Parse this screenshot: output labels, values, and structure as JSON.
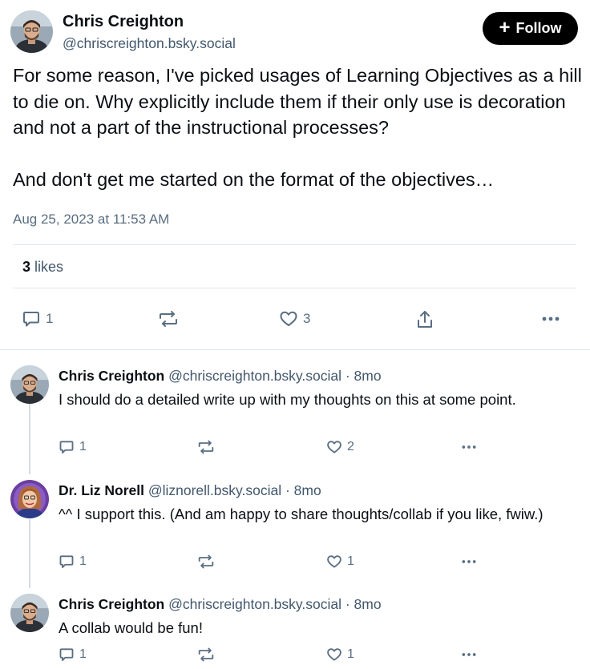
{
  "post": {
    "author_name": "Chris Creighton",
    "author_handle": "@chriscreighton.bsky.social",
    "follow_label": "Follow",
    "text": "For some reason, I've picked usages of Learning Objectives as a hill to die on. Why explicitly include them if their only use is decoration and not a part of the instructional processes?\n\nAnd don't get me started on the format of the objectives…",
    "timestamp": "Aug 25, 2023 at 11:53 AM",
    "likes_count": "3",
    "likes_label": "likes",
    "actions": {
      "reply_count": "1",
      "repost_count": "",
      "like_count": "3"
    }
  },
  "replies": [
    {
      "name": "Chris Creighton",
      "handle": "@chriscreighton.bsky.social",
      "time": "8mo",
      "text": "I should do a detailed write up with my thoughts on this at some point.",
      "reply_count": "1",
      "repost_count": "",
      "like_count": "2"
    },
    {
      "name": "Dr. Liz Norell",
      "handle": "@liznorell.bsky.social",
      "time": "8mo",
      "text": "^^ I support this. (And am happy to share thoughts/collab if you like, fwiw.)",
      "reply_count": "1",
      "repost_count": "",
      "like_count": "1"
    },
    {
      "name": "Chris Creighton",
      "handle": "@chriscreighton.bsky.social",
      "time": "8mo",
      "text": "A collab would be fun!",
      "reply_count": "1",
      "repost_count": "",
      "like_count": "1"
    }
  ],
  "separator": "·",
  "colors": {
    "text_primary": "#0b0f14",
    "text_secondary": "#42576c",
    "icon_gray": "#5a6e82",
    "divider": "#dfe5eb",
    "follow_bg": "#000000"
  },
  "icons": {
    "reply": "speech-bubble-icon",
    "repost": "repost-arrows-icon",
    "like": "heart-icon",
    "share": "share-upload-icon",
    "more": "ellipsis-icon",
    "follow": "plus-icon"
  }
}
